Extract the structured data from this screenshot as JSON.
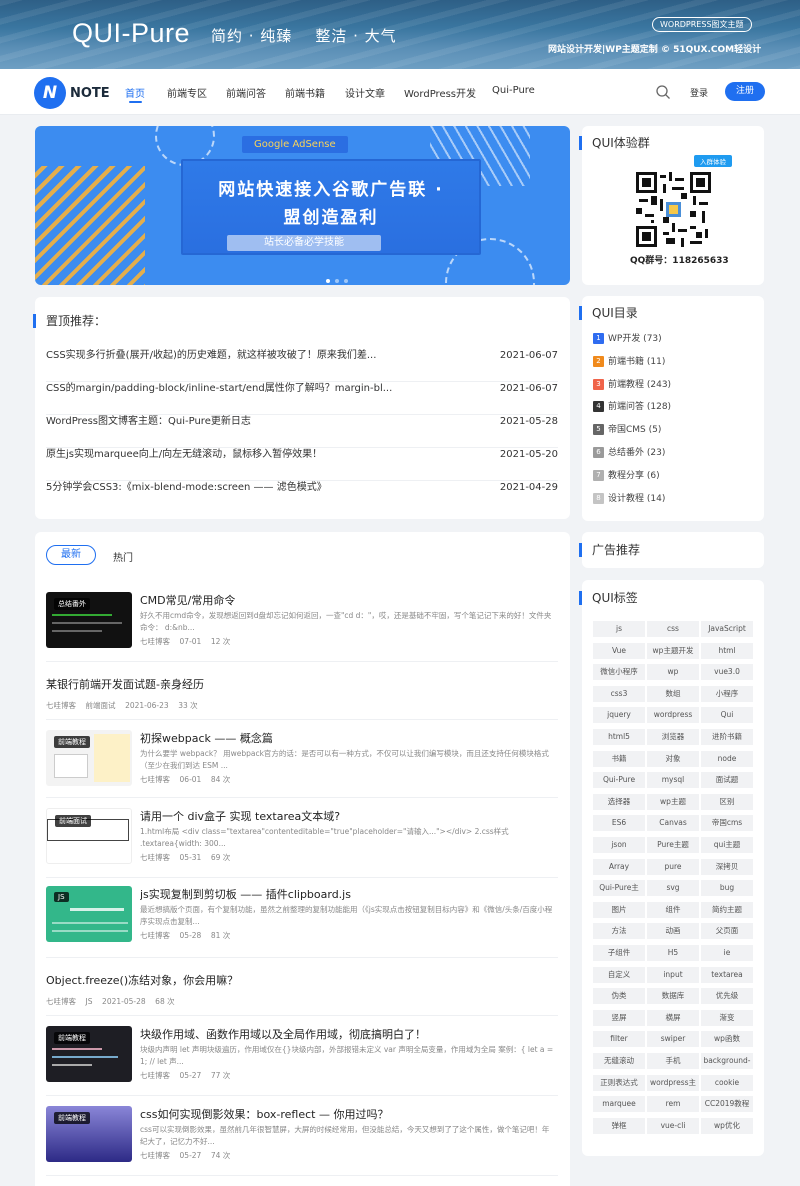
{
  "hero": {
    "logo": "QUI-Pure",
    "slogan": "简约 · 纯臻    整洁 · 大气",
    "badge": "WORDPRESS图文主题",
    "note": "网站设计开发|WP主题定制 © 51QUX.COM轻设计"
  },
  "nav": {
    "logo_mark": "N",
    "logo_text": "NOTE",
    "items": [
      "首页",
      "前端专区",
      "前端问答",
      "前端书籍",
      "设计文章",
      "WordPress开发",
      "Qui-Pure"
    ],
    "login": "登录",
    "register": "注册"
  },
  "banner": {
    "pill": "Google AdSense",
    "title_line1": "网站快速接入谷歌广告联 ·",
    "title_line2": "盟创造盈利",
    "subtitle": "站长必备必学技能"
  },
  "top": {
    "title": "置顶推荐：",
    "items": [
      {
        "title": "CSS实现多行折叠(展开/收起)的历史难题，就这样被攻破了！原来我们差...",
        "date": "2021-06-07"
      },
      {
        "title": "CSS的margin/padding-block/inline-start/end属性你了解吗？margin-bl...",
        "date": "2021-06-07"
      },
      {
        "title": "WordPress图文博客主题：Qui-Pure更新日志",
        "date": "2021-05-28"
      },
      {
        "title": "原生js实现marquee向上/向左无缝滚动，鼠标移入暂停效果！",
        "date": "2021-05-20"
      },
      {
        "title": "5分钟学会CSS3:《mix-blend-mode:screen —— 滤色模式》",
        "date": "2021-04-29"
      }
    ]
  },
  "tabs": {
    "latest": "最新",
    "hot": "热门"
  },
  "posts": [
    {
      "tag": "总结番外",
      "title": "CMD常见/常用命令",
      "excerpt": "好久不用cmd命令，发现想返回到d盘却忘记如何返回，一查\"cd d：\"，哎，还是基础不牢固，写个笔记记下来的好！文件夹命令： d:&nb...",
      "meta": "七哇博客    07-01    12 次"
    },
    {
      "title": "某银行前端开发面试题-亲身经历",
      "meta": "七哇博客    前端面试    2021-06-23    33 次"
    },
    {
      "tag": "前端教程",
      "title": "初探webpack —— 概念篇",
      "excerpt": "为什么要学 webpack？ 用webpack官方的话：是否可以有一种方式，不仅可以让我们编写模块，而且还支持任何模块格式（至少在我们到达 ESM ...",
      "meta": "七哇博客    06-01    84 次"
    },
    {
      "tag": "前端面试",
      "title": "请用一个 div盒子 实现 textarea文本域?",
      "excerpt": "1.html布局 <div class=\"textarea\"contenteditable=\"true\"placeholder=\"请输入...\"></div> 2.css样式 .textarea{width: 300...",
      "meta": "七哇博客    05-31    69 次"
    },
    {
      "tag": "JS",
      "title": "js实现复制到剪切板 —— 插件clipboard.js",
      "excerpt": "最近想搞版个页面，有个复制功能，虽然之前整理的复制功能能用（《js实现点击按钮复制目标内容》和《微信/头条/百度小程序实现点击复制...",
      "meta": "七哇博客    05-28    81 次"
    },
    {
      "title": "Object.freeze()冻结对象，你会用嘛？",
      "meta": "七哇博客    JS    2021-05-28    68 次"
    },
    {
      "tag": "前端教程",
      "title": "块级作用域、函数作用域以及全局作用域，彻底搞明白了！",
      "excerpt": "块级内声明 let 声明块级遍历，作用域仅在{}块级内部，外部报错未定义 var 声明全局变量，作用域为全局 案例：{ let a = 1; // let 声...",
      "meta": "七哇博客    05-27    77 次"
    },
    {
      "tag": "前端教程",
      "title": "css如何实现倒影效果：box-reflect — 你用过吗？",
      "excerpt": "css可以实现倒影效果，虽然前几年很智慧屏，大屏的时候经常用，但没能总结，今天又想到了了这个属性，做个笔记吧！年纪大了，记忆力不好...",
      "meta": "七哇博客    05-27    74 次"
    }
  ],
  "qq": {
    "title": "QUI体验群",
    "badge": "入群体验",
    "caption": "QQ群号：118265633"
  },
  "catalog": {
    "title": "QUI目录",
    "items": [
      {
        "num": "1",
        "label": "WP开发 (73)",
        "color": "#2f6cf0"
      },
      {
        "num": "2",
        "label": "前端书籍 (11)",
        "color": "#f08a1c"
      },
      {
        "num": "3",
        "label": "前端教程 (243)",
        "color": "#f0644a"
      },
      {
        "num": "4",
        "label": "前端问答 (128)",
        "color": "#333333"
      },
      {
        "num": "5",
        "label": "帝国CMS (5)",
        "color": "#666666"
      },
      {
        "num": "6",
        "label": "总结番外 (23)",
        "color": "#9a9a9a"
      },
      {
        "num": "7",
        "label": "教程分享 (6)",
        "color": "#b0b0b0"
      },
      {
        "num": "8",
        "label": "设计教程 (14)",
        "color": "#c4c4c4"
      }
    ]
  },
  "ads": {
    "title": "广告推荐"
  },
  "tags": {
    "title": "QUI标签",
    "items": [
      "js",
      "css",
      "JavaScript",
      "Vue",
      "wp主题开发",
      "html",
      "微信小程序",
      "wp",
      "vue3.0",
      "css3",
      "数组",
      "小程序",
      "jquery",
      "wordpress",
      "Qui",
      "html5",
      "浏览器",
      "进阶书籍",
      "书籍",
      "对象",
      "node",
      "Qui-Pure",
      "mysql",
      "面试题",
      "选择器",
      "wp主题",
      "区别",
      "ES6",
      "Canvas",
      "帝国cms",
      "json",
      "Pure主题",
      "qui主题",
      "Array",
      "pure",
      "深拷贝",
      "Qui-Pure主",
      "svg",
      "bug",
      "图片",
      "组件",
      "简约主题",
      "方法",
      "动画",
      "父页面",
      "子组件",
      "H5",
      "ie",
      "自定义",
      "input",
      "textarea",
      "伪类",
      "数据库",
      "优先级",
      "竖屏",
      "横屏",
      "渐变",
      "filter",
      "swiper",
      "wp函数",
      "无缝滚动",
      "手机",
      "background-",
      "正则表达式",
      "wordpress主",
      "cookie",
      "marquee",
      "rem",
      "CC2019教程",
      "弹框",
      "vue-cli",
      "wp优化"
    ]
  }
}
